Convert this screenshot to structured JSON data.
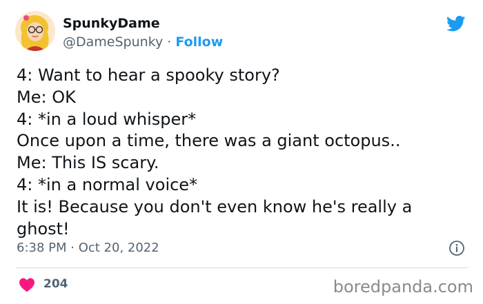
{
  "user": {
    "display_name": "SpunkyDame",
    "handle": "@DameSpunky",
    "separator": " · ",
    "follow_label": "Follow"
  },
  "tweet": {
    "lines": [
      "4: Want to hear a spooky story?",
      "Me: OK",
      "4: *in a loud whisper*",
      "Once upon a time, there was a giant octopus..",
      "Me: This IS scary.",
      "4: *in a normal voice*",
      "It is! Because you don't even know he's really a",
      "ghost!"
    ],
    "timestamp": "6:38 PM · Oct 20, 2022",
    "like_count": "204"
  },
  "watermark": "boredpanda.com",
  "colors": {
    "twitter_blue": "#1d9bf0",
    "heart_red": "#f91880",
    "secondary_text": "#536471"
  },
  "icons": {
    "brand": "twitter-bird-icon",
    "info": "info-icon",
    "like": "heart-icon"
  }
}
